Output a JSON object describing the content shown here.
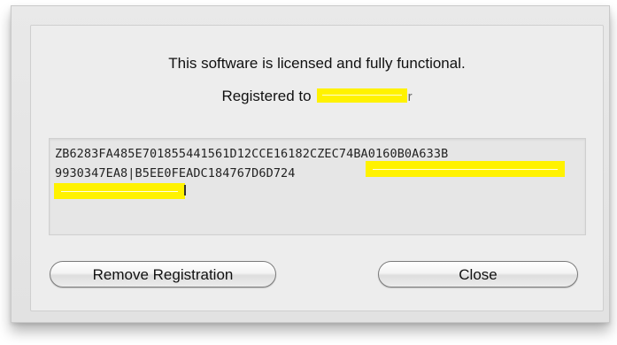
{
  "dialog": {
    "message": "This software is licensed and fully functional.",
    "registered_label": "Registered to",
    "registered_name_tail": "r"
  },
  "license": {
    "key_line1": "ZB6283FA485E701855441561D12CCE16182CZEC74BA0160B0A633B",
    "key_line2": "9930347EA8|B5EE0FEADC184767D6D724"
  },
  "buttons": {
    "remove_label": "Remove Registration",
    "close_label": "Close"
  },
  "colors": {
    "redaction": "#fff200",
    "panel": "#ededed"
  }
}
